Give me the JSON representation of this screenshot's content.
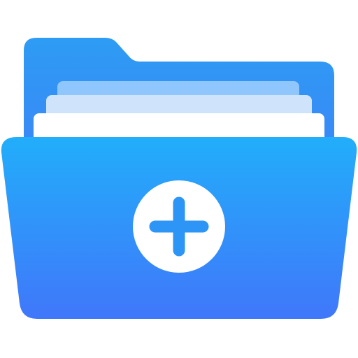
{
  "icon": {
    "name": "add-folder-icon",
    "colors": {
      "back_top": "#2D9CF4",
      "back_bottom": "#3E82F7",
      "paper_back": "#8FC6FB",
      "paper_middle": "#CFE3FB",
      "paper_front": "#FFFFFF",
      "front_top": "#22AEFA",
      "front_bottom": "#4077FA",
      "badge_circle": "#FFFFFF",
      "badge_plus": "#2D95F6"
    }
  }
}
